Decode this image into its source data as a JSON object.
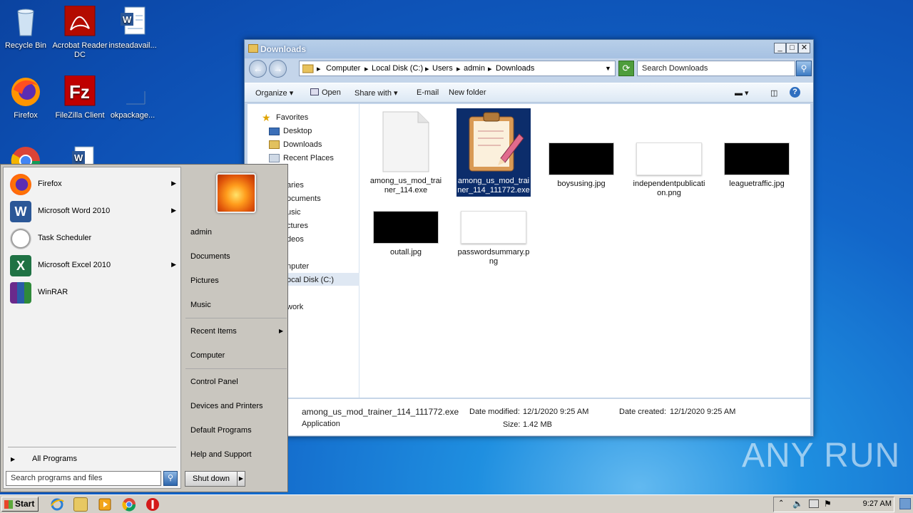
{
  "desktop": {
    "icons": [
      {
        "label": "Recycle Bin"
      },
      {
        "label": "Acrobat Reader DC"
      },
      {
        "label": "insteadavail..."
      },
      {
        "label": "Firefox"
      },
      {
        "label": "FileZilla Client"
      },
      {
        "label": "okpackage..."
      }
    ]
  },
  "explorer": {
    "title": "Downloads",
    "breadcrumb": [
      "Computer",
      "Local Disk (C:)",
      "Users",
      "admin",
      "Downloads"
    ],
    "search_placeholder": "Search Downloads",
    "toolbar": {
      "organize": "Organize",
      "open": "Open",
      "share": "Share with",
      "email": "E-mail",
      "new_folder": "New folder"
    },
    "nav": {
      "favorites": "Favorites",
      "desktop": "Desktop",
      "downloads": "Downloads",
      "recent": "Recent Places",
      "libraries": "aries",
      "documents": "ocuments",
      "music": "usic",
      "pictures": "ctures",
      "videos": "deos",
      "computer": "nputer",
      "local_disk": "ocal Disk (C:)",
      "network": "work"
    },
    "files": [
      {
        "name": "among_us_mod_trainer_114.exe"
      },
      {
        "name": "among_us_mod_trainer_114_111772.exe"
      },
      {
        "name": "boysusing.jpg"
      },
      {
        "name": "independentpublication.png"
      },
      {
        "name": "leaguetraffic.jpg"
      },
      {
        "name": "outall.jpg"
      },
      {
        "name": "passwordsummary.png"
      }
    ],
    "details": {
      "filename": "among_us_mod_trainer_114_111772.exe",
      "type": "Application",
      "modified_label": "Date modified:",
      "modified_value": "12/1/2020 9:25 AM",
      "created_label": "Date created:",
      "created_value": "12/1/2020 9:25 AM",
      "size_label": "Size:",
      "size_value": "1.42 MB"
    }
  },
  "start_menu": {
    "programs": [
      {
        "label": "Firefox",
        "has_submenu": true
      },
      {
        "label": "Microsoft Word 2010",
        "has_submenu": true
      },
      {
        "label": "Task Scheduler",
        "has_submenu": false
      },
      {
        "label": "Microsoft Excel 2010",
        "has_submenu": true
      },
      {
        "label": "WinRAR",
        "has_submenu": false
      }
    ],
    "all_programs": "All Programs",
    "search_placeholder": "Search programs and files",
    "right": {
      "user": "admin",
      "documents": "Documents",
      "pictures": "Pictures",
      "music": "Music",
      "recent_items": "Recent Items",
      "computer": "Computer",
      "control_panel": "Control Panel",
      "devices": "Devices and Printers",
      "default_programs": "Default Programs",
      "help": "Help and Support"
    },
    "shutdown": "Shut down"
  },
  "taskbar": {
    "start": "Start",
    "clock": "9:27 AM"
  },
  "watermark": "ANY RUN"
}
